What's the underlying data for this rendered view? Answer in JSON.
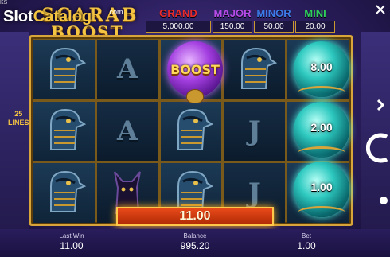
{
  "corner_text": "KS",
  "watermark": {
    "part1": "Slot",
    "part2": "Catalog"
  },
  "logo": {
    "line1": "SCARAB",
    "line2": "BOOST",
    "suffix": ".com"
  },
  "jackpots": [
    {
      "name": "GRAND",
      "value": "5,000.00"
    },
    {
      "name": "MAJOR",
      "value": "150.00"
    },
    {
      "name": "MINOR",
      "value": "50.00"
    },
    {
      "name": "MINI",
      "value": "20.00"
    }
  ],
  "lines": {
    "count": "25",
    "label": "LINES"
  },
  "boost_label": "BOOST",
  "orb_values": [
    "8.00",
    "2.00",
    "1.00"
  ],
  "reel_symbols": [
    [
      "horus",
      "A",
      "boost",
      "horus",
      "orb"
    ],
    [
      "horus",
      "A",
      "horus",
      "J",
      "orb"
    ],
    [
      "horus",
      "cat",
      "horus",
      "J",
      "orb"
    ]
  ],
  "win_amount": "11.00",
  "bottom": {
    "last_win_label": "Last Win",
    "last_win_value": "11.00",
    "balance_label": "Balance",
    "balance_value": "995.20",
    "bet_label": "Bet",
    "bet_value": "1.00"
  },
  "colors": {
    "grand": "#e82a2a",
    "major": "#b64be8",
    "minor": "#3b7be8",
    "mini": "#2fd05a",
    "gold": "#d8a53a",
    "win_box": "#e84a1a"
  }
}
